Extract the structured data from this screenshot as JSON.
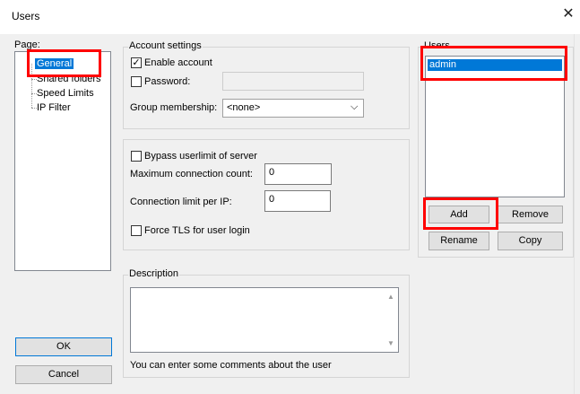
{
  "window": {
    "title": "Users",
    "close_glyph": "✕"
  },
  "page": {
    "label": "Page:",
    "items": [
      {
        "label": "General"
      },
      {
        "label": "Shared folders"
      },
      {
        "label": "Speed Limits"
      },
      {
        "label": "IP Filter"
      }
    ],
    "selected": "General"
  },
  "account": {
    "group_label": "Account settings",
    "enable_label": "Enable account",
    "enable_checked": true,
    "password_label": "Password:",
    "password_value": "",
    "group_membership_label": "Group membership:",
    "group_membership_value": "<none>"
  },
  "limits": {
    "bypass_label": "Bypass userlimit of server",
    "max_conn_label": "Maximum connection count:",
    "max_conn_value": "0",
    "per_ip_label": "Connection limit per IP:",
    "per_ip_value": "0",
    "tls_label": "Force TLS for user login"
  },
  "description": {
    "group_label": "Description",
    "value": "",
    "hint": "You can enter some comments about the user"
  },
  "users": {
    "group_label": "Users",
    "items": [
      {
        "label": "admin",
        "selected": true
      }
    ],
    "add_label": "Add",
    "remove_label": "Remove",
    "rename_label": "Rename",
    "copy_label": "Copy"
  },
  "footer": {
    "ok_label": "OK",
    "cancel_label": "Cancel"
  },
  "colors": {
    "selection": "#0078d7",
    "highlight_box": "#ff0000",
    "focus": "#0078d7"
  },
  "icons": {
    "close": "close-icon",
    "dropdown": "chevron-down-icon",
    "scroll_up": "scroll-up-icon",
    "scroll_down": "scroll-down-icon",
    "check": "checkmark-icon"
  }
}
